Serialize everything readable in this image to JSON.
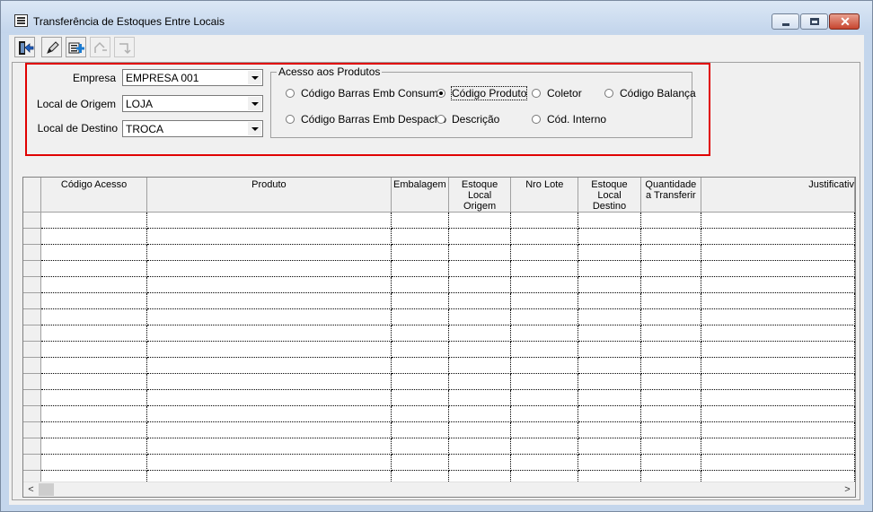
{
  "window": {
    "title": "Transferência de Estoques Entre Locais",
    "close_glyph": "✕"
  },
  "toolbar": {
    "buttons": [
      {
        "icon": "exit-door-icon",
        "enabled": true
      },
      {
        "icon": "pencil-edit-icon",
        "enabled": true
      },
      {
        "icon": "add-item-icon",
        "enabled": true
      },
      {
        "icon": "undo-icon",
        "enabled": false
      },
      {
        "icon": "redo-icon",
        "enabled": false
      }
    ]
  },
  "form": {
    "empresa_label": "Empresa",
    "empresa_value": "EMPRESA 001",
    "origem_label": "Local de Origem",
    "origem_value": "LOJA",
    "destino_label": "Local de Destino",
    "destino_value": "TROCA"
  },
  "acesso": {
    "title": "Acesso aos Produtos",
    "options": [
      {
        "label": "Código Barras Emb Consumo",
        "selected": false
      },
      {
        "label": "Código Produto",
        "selected": true
      },
      {
        "label": "Coletor",
        "selected": false
      },
      {
        "label": "Código Balança",
        "selected": false
      },
      {
        "label": "Código Barras Emb Despacho",
        "selected": false
      },
      {
        "label": "Descrição",
        "selected": false
      },
      {
        "label": "Cód. Interno",
        "selected": false
      }
    ]
  },
  "grid": {
    "columns": [
      "Código Acesso",
      "Produto",
      "Embalagem",
      "Estoque Local Origem",
      "Nro Lote",
      "Estoque Local Destino",
      "Quantidade a Transferir",
      "Justificativ"
    ],
    "scroll_left": "<",
    "scroll_right": ">"
  },
  "colors": {
    "highlight_border": "#e00000",
    "window_frame": "#c4d6ec"
  }
}
